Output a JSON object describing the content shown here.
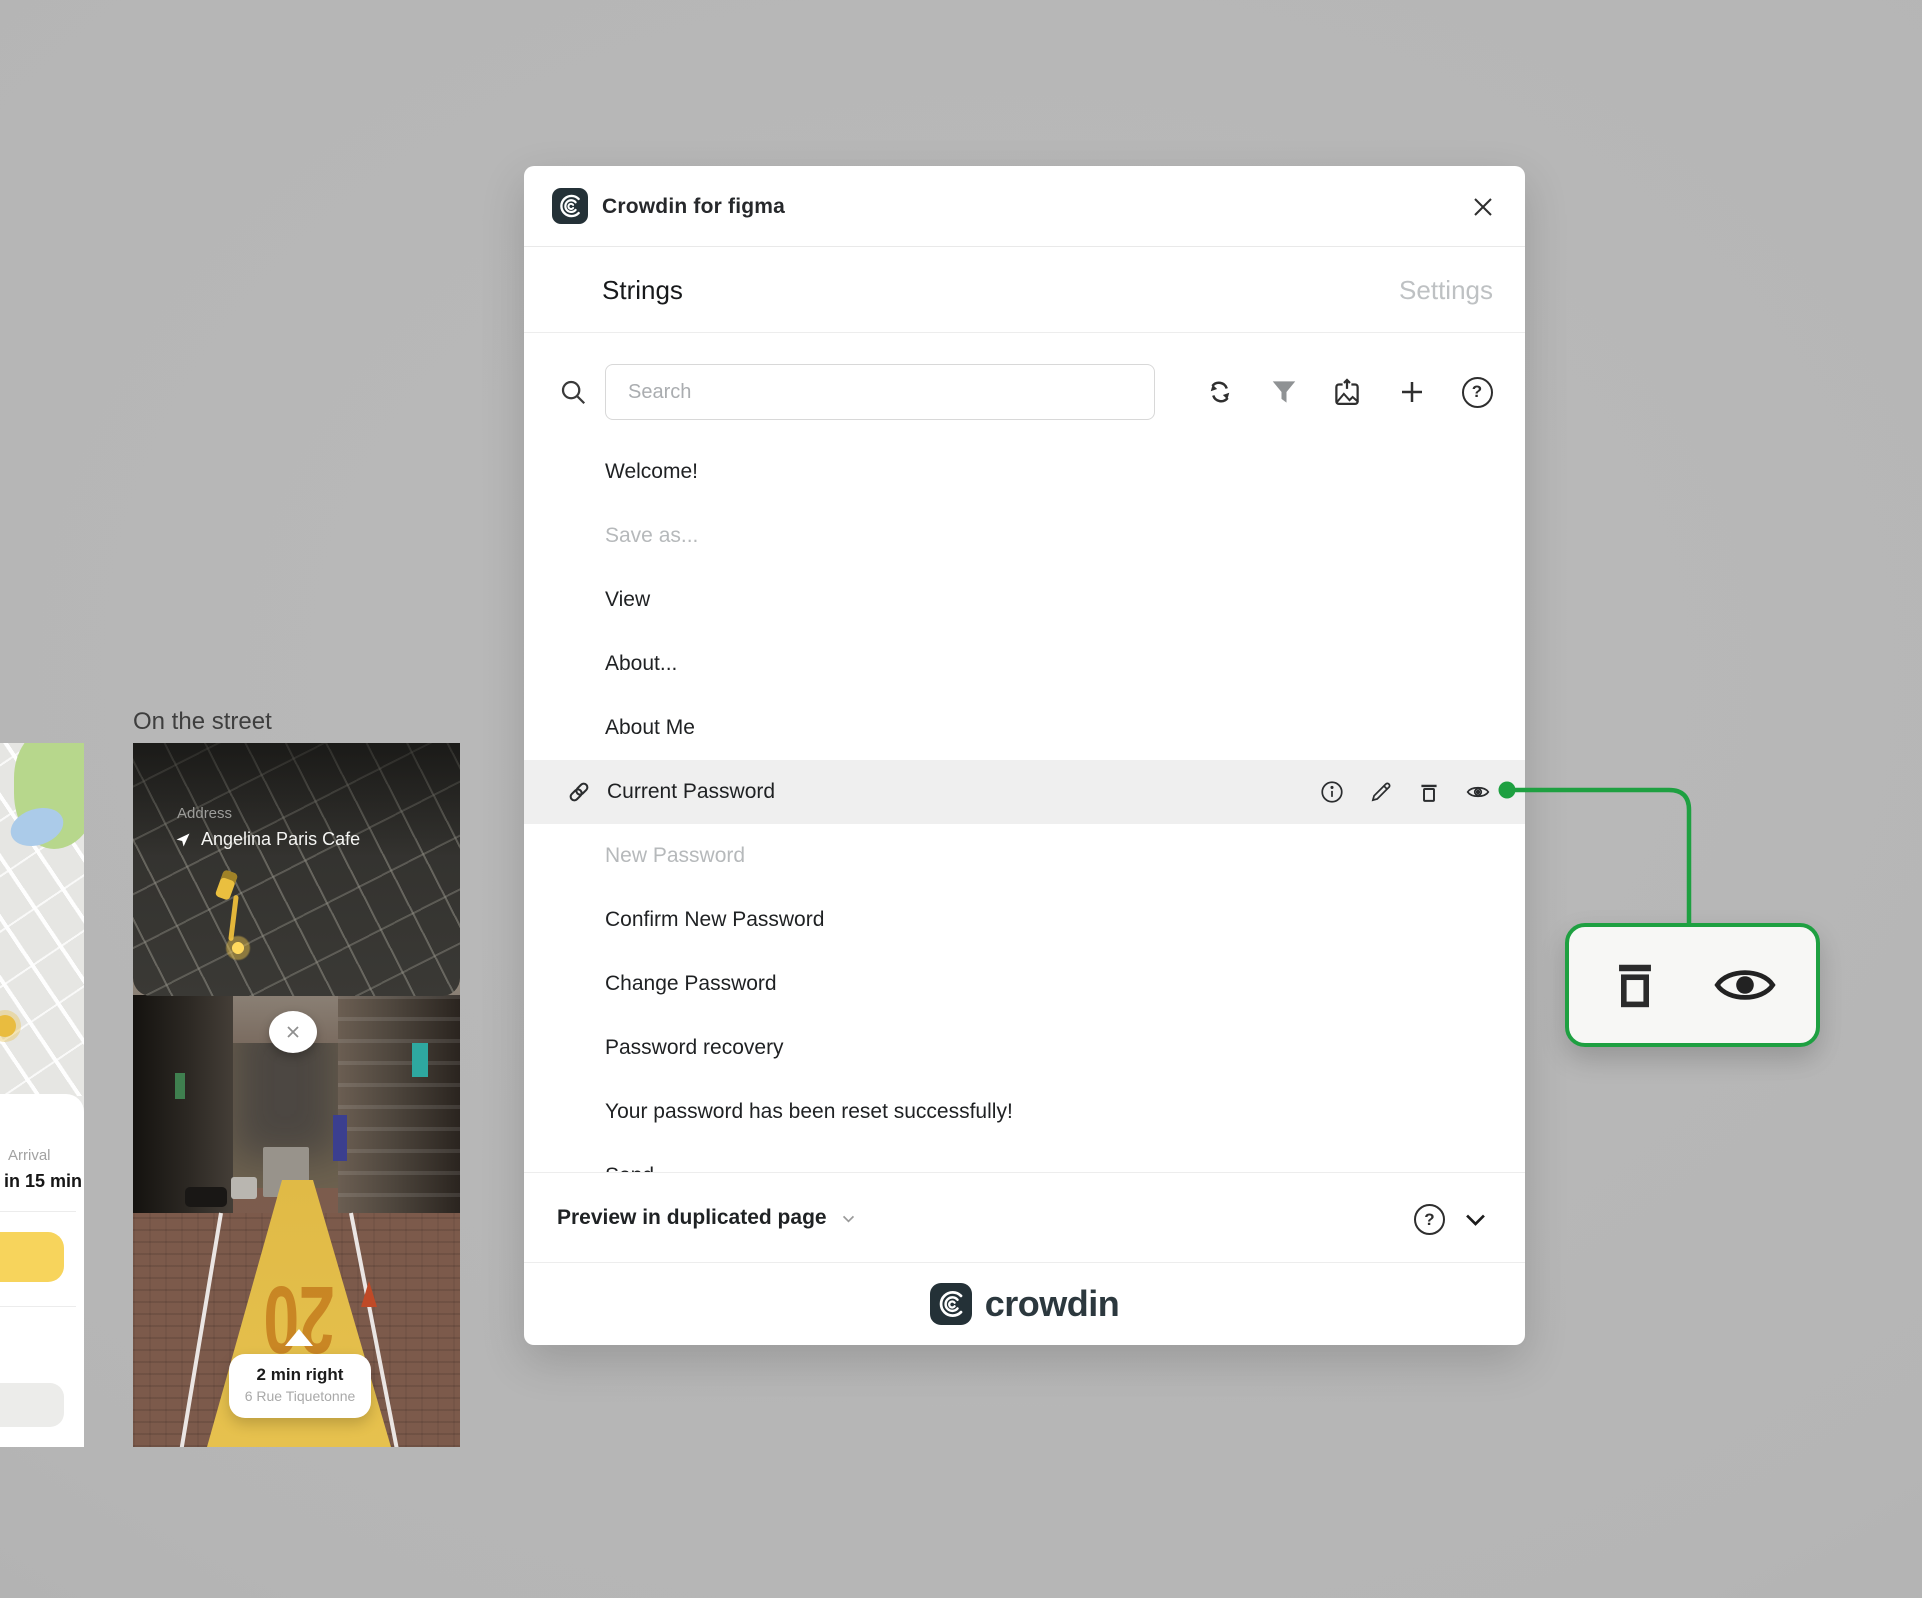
{
  "window": {
    "title": "Crowdin for figma"
  },
  "tabs": {
    "strings": "Strings",
    "settings": "Settings"
  },
  "toolbar": {
    "search_placeholder": "Search"
  },
  "strings": {
    "items": [
      {
        "text": "Welcome!",
        "state": "normal"
      },
      {
        "text": "Save as...",
        "state": "muted"
      },
      {
        "text": "View",
        "state": "normal"
      },
      {
        "text": "About...",
        "state": "normal"
      },
      {
        "text": "About Me",
        "state": "normal"
      },
      {
        "text": "Current Password",
        "state": "selected"
      },
      {
        "text": "New Password",
        "state": "muted"
      },
      {
        "text": "Confirm New Password",
        "state": "normal"
      },
      {
        "text": "Change Password",
        "state": "normal"
      },
      {
        "text": "Password recovery",
        "state": "normal"
      },
      {
        "text": "Your password has been reset successfully!",
        "state": "normal"
      },
      {
        "text": "Send",
        "state": "partial"
      }
    ]
  },
  "preview": {
    "label": "Preview in duplicated page"
  },
  "footer": {
    "wordmark": "crowdin"
  },
  "glyphs": {
    "help": "?",
    "close_pill": "×"
  },
  "canvas": {
    "street_frame": {
      "label": "On the street",
      "address_label": "Address",
      "address_value": "Angelina Paris Cafe",
      "road_number": "20",
      "direction": "2 min right",
      "street_name": "6 Rue Tiquetonne"
    },
    "left_frame": {
      "arrival_label": "Arrival",
      "arrival_value": "in 15 min"
    }
  },
  "colors": {
    "accent_green": "#1EA041",
    "selected_row_bg": "#EFEFEF",
    "canvas_bg": "#B5B5B5",
    "brand_dark": "#243137",
    "taxi_yellow": "#E9BC3F",
    "ar_path_yellow": "#E0BA46"
  }
}
